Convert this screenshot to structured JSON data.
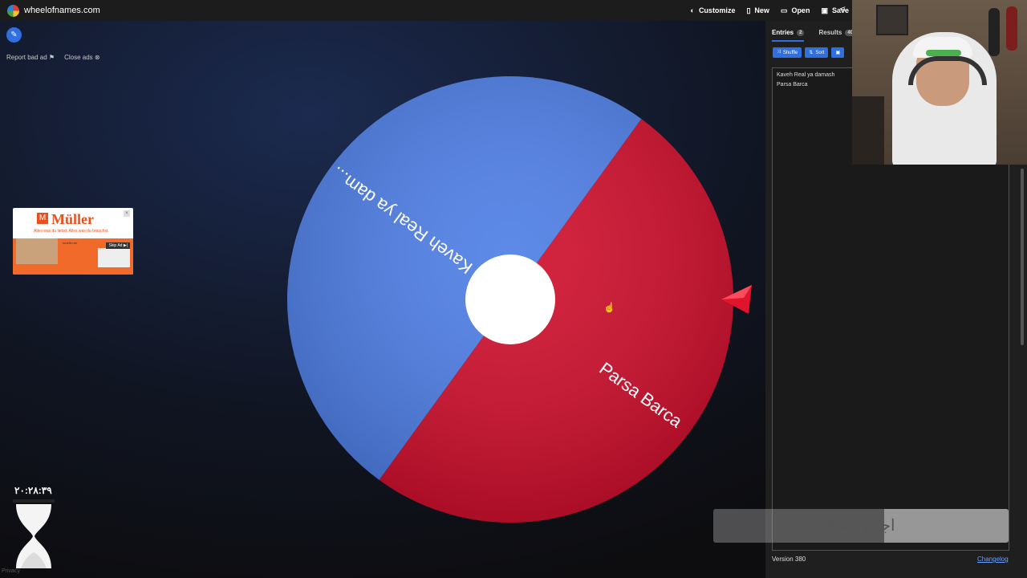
{
  "site": {
    "name": "wheelofnames.com"
  },
  "topnav": {
    "customize": "Customize",
    "new": "New",
    "open": "Open",
    "save": "Save"
  },
  "adlinks": {
    "report": "Report bad ad",
    "close": "Close ads"
  },
  "ad": {
    "brand": "Müller",
    "tagline": "Alles was du liebst. Alles was du brauchst.",
    "url": "mueller.de",
    "skip": "Skip Ad"
  },
  "wheel": {
    "segments": [
      {
        "label": "Kaveh Real ya dam...",
        "color": "#4f7fe6"
      },
      {
        "label": "Parsa Barca",
        "color": "#d0102e"
      }
    ],
    "pointer_color": "#e0142c"
  },
  "timer": {
    "value": "٢٠:٢٨:٣٩"
  },
  "panel": {
    "tabs": [
      {
        "label": "Entries",
        "count": "2",
        "active": true
      },
      {
        "label": "Results",
        "count": "40",
        "active": false
      }
    ],
    "toolbar": {
      "shuffle": "Shuffle",
      "sort": "Sort"
    },
    "entries": [
      "Kaveh Real ya damash",
      "Parsa Barca"
    ],
    "version": "Version 380",
    "changelog": "Changelog"
  },
  "progress": {
    "label": "اجاق 42%",
    "fraction": 0.42
  },
  "privacy": "Privacy"
}
